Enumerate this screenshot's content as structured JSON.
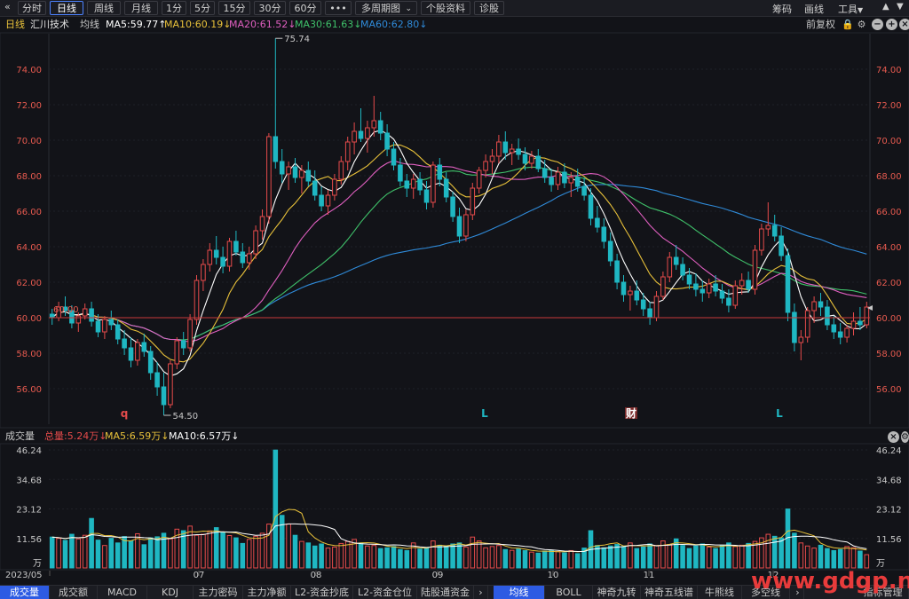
{
  "toolbar": {
    "back_icon": "double-chevron-left-icon",
    "periods": [
      "分时",
      "日线",
      "周线",
      "月线",
      "1分",
      "5分",
      "15分",
      "30分",
      "60分",
      "•••"
    ],
    "active_period": "日线",
    "multi_period": "多周期图",
    "stock_info": "个股资料",
    "diagnose": "诊股",
    "right": {
      "chip": "筹码",
      "draw": "画线",
      "tools": "工具"
    }
  },
  "legend": {
    "period": "日线",
    "stock": "汇川技术",
    "avg": "均线",
    "ma5": "MA5:59.77↑",
    "ma10": "MA10:60.19↓",
    "ma20": "MA20:61.52↓",
    "ma30": "MA30:61.63↓",
    "ma60": "MA60:62.80↓",
    "adjust": "前复权"
  },
  "vol_legend": {
    "name": "成交量",
    "total": "总量:5.24万↓",
    "ma5": "MA5:6.59万↓",
    "ma10": "MA10:6.57万↓"
  },
  "colors": {
    "up": "#e64b4b",
    "down": "#1fb7c2",
    "ma5": "#ffffff",
    "ma10": "#e8c13a",
    "ma20": "#e05fc0",
    "ma30": "#3fc16a",
    "ma60": "#2f8ad8",
    "price_axis": "#e65a4f"
  },
  "chart_data": {
    "type": "candlestick",
    "y_ticks": [
      "56.00",
      "58.00",
      "60.00",
      "62.00",
      "64.00",
      "66.00",
      "68.00",
      "70.00",
      "72.00",
      "74.00"
    ],
    "ylim": [
      54.0,
      76.0
    ],
    "ref_price": 60.0,
    "ref_label": "60.00",
    "high_label": "75.74",
    "low_label": "54.50",
    "months": [
      "2023/05",
      "07",
      "08",
      "09",
      "10",
      "11",
      "12"
    ],
    "event_markers": [
      "q",
      "L",
      "财",
      "L"
    ],
    "vol_ticks": [
      "46.24",
      "34.68",
      "23.12",
      "11.56",
      "万"
    ],
    "vol_ylim": [
      0,
      48
    ],
    "candles": [
      [
        60.2,
        60.5,
        59.6,
        60.0
      ],
      [
        60.0,
        60.9,
        59.8,
        60.6
      ],
      [
        60.6,
        61.2,
        60.1,
        60.4
      ],
      [
        60.4,
        60.7,
        59.4,
        59.7
      ],
      [
        59.7,
        60.3,
        59.2,
        60.1
      ],
      [
        60.1,
        60.8,
        59.9,
        60.5
      ],
      [
        60.5,
        60.9,
        59.5,
        59.8
      ],
      [
        59.8,
        60.2,
        58.9,
        59.2
      ],
      [
        59.2,
        60.1,
        58.8,
        59.9
      ],
      [
        59.9,
        60.4,
        59.3,
        59.6
      ],
      [
        59.6,
        59.9,
        58.5,
        58.8
      ],
      [
        58.8,
        59.3,
        57.9,
        58.3
      ],
      [
        58.3,
        58.9,
        57.2,
        57.6
      ],
      [
        57.6,
        58.8,
        57.3,
        58.6
      ],
      [
        58.6,
        59.1,
        57.8,
        58.1
      ],
      [
        58.1,
        58.4,
        56.5,
        56.9
      ],
      [
        56.9,
        57.5,
        55.6,
        56.1
      ],
      [
        56.1,
        56.9,
        54.5,
        55.1
      ],
      [
        55.1,
        57.6,
        54.9,
        57.4
      ],
      [
        57.4,
        58.9,
        57.1,
        58.7
      ],
      [
        58.7,
        59.2,
        57.9,
        58.3
      ],
      [
        58.3,
        60.2,
        58.1,
        59.9
      ],
      [
        59.9,
        62.4,
        59.6,
        62.1
      ],
      [
        62.1,
        63.3,
        61.5,
        63.0
      ],
      [
        63.0,
        64.2,
        62.6,
        63.8
      ],
      [
        63.8,
        64.6,
        63.0,
        63.4
      ],
      [
        63.4,
        64.0,
        62.5,
        62.9
      ],
      [
        62.9,
        64.5,
        62.6,
        64.3
      ],
      [
        64.3,
        64.9,
        63.5,
        63.7
      ],
      [
        63.7,
        64.2,
        62.8,
        63.1
      ],
      [
        63.1,
        64.0,
        62.7,
        63.6
      ],
      [
        63.6,
        65.2,
        63.3,
        64.9
      ],
      [
        64.9,
        66.1,
        64.4,
        65.7
      ],
      [
        65.7,
        70.4,
        65.3,
        70.2
      ],
      [
        70.2,
        75.74,
        68.4,
        68.8
      ],
      [
        68.8,
        69.5,
        67.6,
        68.1
      ],
      [
        68.1,
        68.8,
        67.2,
        68.5
      ],
      [
        68.5,
        69.0,
        67.6,
        67.9
      ],
      [
        67.9,
        68.6,
        67.0,
        68.3
      ],
      [
        68.3,
        68.8,
        67.4,
        67.7
      ],
      [
        67.7,
        68.3,
        66.6,
        66.9
      ],
      [
        66.9,
        67.4,
        66.0,
        66.3
      ],
      [
        66.3,
        67.2,
        65.8,
        66.9
      ],
      [
        66.9,
        68.1,
        66.6,
        67.8
      ],
      [
        67.8,
        69.1,
        67.5,
        68.8
      ],
      [
        68.8,
        70.2,
        68.3,
        69.9
      ],
      [
        69.9,
        71.0,
        69.2,
        70.5
      ],
      [
        70.5,
        71.8,
        69.9,
        70.1
      ],
      [
        70.1,
        71.1,
        69.3,
        70.7
      ],
      [
        70.7,
        72.5,
        70.2,
        71.1
      ],
      [
        71.1,
        71.6,
        70.0,
        70.4
      ],
      [
        70.4,
        70.9,
        69.1,
        69.5
      ],
      [
        69.5,
        69.9,
        68.3,
        68.6
      ],
      [
        68.6,
        69.0,
        67.4,
        67.7
      ],
      [
        67.7,
        68.1,
        66.8,
        67.3
      ],
      [
        67.3,
        68.1,
        66.7,
        67.8
      ],
      [
        67.8,
        68.2,
        66.9,
        67.2
      ],
      [
        67.2,
        67.7,
        66.1,
        66.5
      ],
      [
        66.5,
        68.8,
        66.2,
        68.6
      ],
      [
        68.6,
        69.0,
        67.4,
        67.8
      ],
      [
        67.8,
        68.2,
        66.5,
        66.8
      ],
      [
        66.8,
        67.1,
        65.4,
        65.7
      ],
      [
        65.7,
        66.2,
        64.2,
        64.6
      ],
      [
        64.6,
        66.1,
        64.3,
        65.8
      ],
      [
        65.8,
        67.6,
        65.5,
        67.3
      ],
      [
        67.3,
        68.5,
        67.0,
        68.3
      ],
      [
        68.3,
        69.2,
        67.9,
        68.8
      ],
      [
        68.8,
        69.5,
        68.1,
        69.1
      ],
      [
        69.1,
        70.3,
        68.7,
        69.9
      ],
      [
        69.9,
        70.5,
        68.9,
        69.3
      ],
      [
        69.3,
        69.8,
        68.6,
        69.5
      ],
      [
        69.5,
        70.1,
        68.9,
        69.2
      ],
      [
        69.2,
        69.6,
        68.3,
        68.7
      ],
      [
        68.7,
        69.4,
        68.4,
        69.1
      ],
      [
        69.1,
        69.5,
        68.2,
        68.4
      ],
      [
        68.4,
        68.9,
        67.6,
        67.9
      ],
      [
        67.9,
        68.4,
        67.1,
        67.5
      ],
      [
        67.5,
        68.5,
        67.2,
        68.2
      ],
      [
        68.2,
        68.7,
        67.3,
        67.6
      ],
      [
        67.6,
        68.2,
        66.8,
        67.9
      ],
      [
        67.9,
        68.4,
        67.1,
        67.4
      ],
      [
        67.4,
        67.9,
        66.6,
        66.9
      ],
      [
        66.9,
        67.3,
        65.2,
        65.6
      ],
      [
        65.6,
        66.3,
        64.8,
        65.1
      ],
      [
        65.1,
        65.6,
        63.9,
        64.3
      ],
      [
        64.3,
        64.8,
        62.9,
        63.2
      ],
      [
        63.2,
        63.6,
        61.6,
        62.0
      ],
      [
        62.0,
        62.4,
        60.9,
        61.3
      ],
      [
        61.3,
        61.8,
        60.4,
        61.5
      ],
      [
        61.5,
        62.1,
        60.7,
        61.0
      ],
      [
        61.0,
        61.4,
        60.1,
        60.5
      ],
      [
        60.5,
        60.9,
        59.6,
        60.0
      ],
      [
        60.0,
        61.5,
        59.8,
        61.2
      ],
      [
        61.2,
        62.6,
        61.0,
        62.3
      ],
      [
        62.3,
        63.7,
        62.0,
        63.4
      ],
      [
        63.4,
        64.1,
        62.7,
        63.0
      ],
      [
        63.0,
        63.4,
        62.1,
        62.4
      ],
      [
        62.4,
        62.8,
        61.6,
        61.9
      ],
      [
        61.9,
        62.5,
        61.2,
        61.6
      ],
      [
        61.6,
        62.1,
        60.9,
        61.4
      ],
      [
        61.4,
        62.2,
        61.1,
        61.9
      ],
      [
        61.9,
        62.4,
        61.2,
        61.5
      ],
      [
        61.5,
        61.9,
        60.8,
        61.1
      ],
      [
        61.1,
        61.6,
        60.3,
        60.7
      ],
      [
        60.7,
        62.1,
        60.5,
        61.8
      ],
      [
        61.8,
        62.5,
        61.3,
        62.1
      ],
      [
        62.1,
        62.6,
        61.4,
        61.6
      ],
      [
        61.6,
        64.1,
        61.3,
        63.8
      ],
      [
        63.8,
        65.3,
        63.5,
        65.0
      ],
      [
        65.0,
        66.5,
        64.6,
        65.2
      ],
      [
        65.2,
        65.8,
        64.3,
        64.6
      ],
      [
        64.6,
        65.1,
        63.2,
        63.5
      ],
      [
        63.5,
        63.9,
        59.8,
        60.3
      ],
      [
        60.3,
        60.8,
        58.1,
        58.6
      ],
      [
        58.6,
        59.3,
        57.6,
        58.9
      ],
      [
        58.9,
        60.6,
        58.6,
        60.4
      ],
      [
        60.4,
        61.2,
        59.7,
        60.9
      ],
      [
        60.9,
        61.4,
        60.1,
        60.6
      ],
      [
        60.6,
        61.0,
        59.3,
        59.6
      ],
      [
        59.6,
        60.1,
        58.8,
        59.2
      ],
      [
        59.2,
        59.7,
        58.5,
        58.9
      ],
      [
        58.9,
        59.6,
        58.6,
        59.4
      ],
      [
        59.4,
        60.3,
        59.0,
        59.8
      ],
      [
        59.8,
        60.6,
        59.3,
        59.6
      ],
      [
        59.6,
        60.9,
        59.4,
        60.6
      ]
    ],
    "volumes": [
      12.1,
      11.6,
      10.8,
      13.2,
      11.4,
      12.8,
      19.4,
      10.9,
      8.8,
      11.6,
      9.8,
      12.3,
      10.6,
      13.4,
      9.1,
      11.8,
      12.2,
      13.6,
      11.4,
      15.2,
      14.6,
      16.4,
      12.8,
      13.2,
      14.5,
      15.8,
      13.9,
      12.7,
      11.8,
      9.6,
      11.2,
      12.4,
      13.6,
      17.2,
      46.2,
      20.6,
      17.2,
      12.8,
      10.4,
      9.8,
      8.6,
      9.4,
      7.8,
      8.2,
      9.6,
      10.4,
      11.2,
      9.8,
      8.6,
      8.8,
      7.6,
      7.9,
      8.4,
      7.2,
      6.8,
      9.8,
      7.4,
      7.8,
      10.6,
      8.9,
      8.6,
      9.4,
      9.8,
      8.2,
      12.1,
      10.6,
      7.9,
      8.4,
      8.8,
      7.2,
      6.9,
      7.4,
      6.8,
      6.2,
      5.8,
      6.6,
      6.9,
      6.4,
      5.9,
      6.8,
      5.6,
      7.8,
      14.6,
      8.8,
      7.9,
      8.6,
      9.2,
      8.4,
      9.8,
      7.6,
      8.2,
      9.4,
      8.8,
      10.6,
      9.2,
      11.4,
      8.8,
      7.6,
      8.6,
      9.4,
      8.2,
      7.6,
      8.8,
      9.8,
      8.4,
      8.9,
      9.6,
      10.4,
      11.8,
      13.2,
      12.4,
      11.8,
      23.1,
      13.6,
      9.8,
      8.6,
      7.8,
      8.9,
      7.6,
      6.8,
      7.2,
      8.4,
      7.9,
      6.6,
      5.2
    ]
  },
  "bottom_tabs": {
    "left": [
      "成交量",
      "成交额",
      "MACD",
      "KDJ",
      "主力密码",
      "主力净额",
      "L2-资金抄底",
      "L2-资金仓位",
      "陆股通资金"
    ],
    "right": [
      "均线",
      "BOLL",
      "神奇九转",
      "神奇五线谱",
      "牛熊线",
      "多空线"
    ],
    "more": "指标管理",
    "watermark": "www.gdgp.net"
  }
}
